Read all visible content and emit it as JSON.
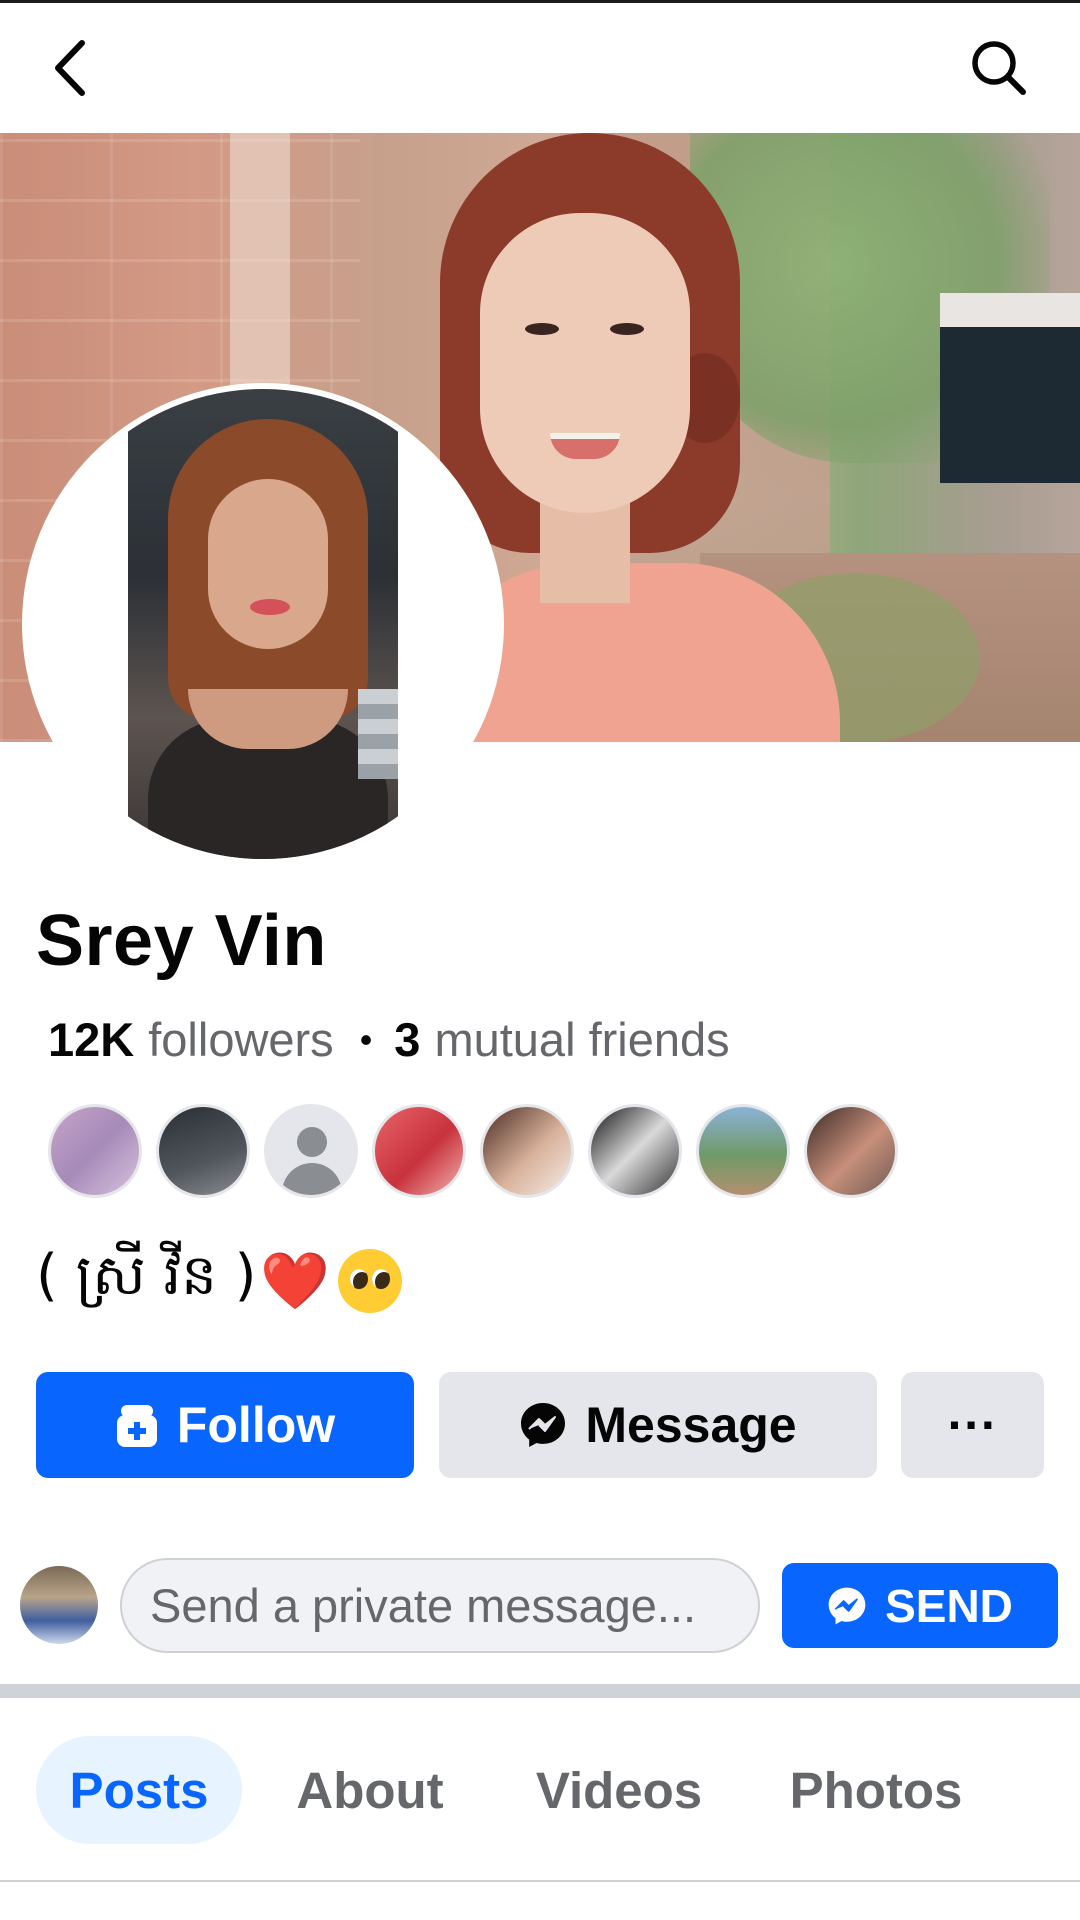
{
  "header": {
    "back_icon": "chevron-left-icon",
    "search_icon": "search-icon"
  },
  "profile": {
    "name": "Srey Vin",
    "followers_count": "12K",
    "followers_label": "followers",
    "separator": "•",
    "mutual_count": "3",
    "mutual_label": "mutual friends",
    "bio_text": "( ស្រី វីន )",
    "bio_emoji_heart": "❤️"
  },
  "actions": {
    "follow_label": "Follow",
    "message_label": "Message",
    "more_label": "···"
  },
  "composer": {
    "placeholder": "Send a private message...",
    "send_label": "SEND"
  },
  "tabs": [
    {
      "label": "Posts",
      "active": true
    },
    {
      "label": "About",
      "active": false
    },
    {
      "label": "Videos",
      "active": false
    },
    {
      "label": "Photos",
      "active": false
    }
  ],
  "colors": {
    "accent": "#0866ff",
    "button_gray": "#e4e6eb",
    "text_secondary": "#65676b",
    "active_tab_bg": "#e7f3ff"
  }
}
